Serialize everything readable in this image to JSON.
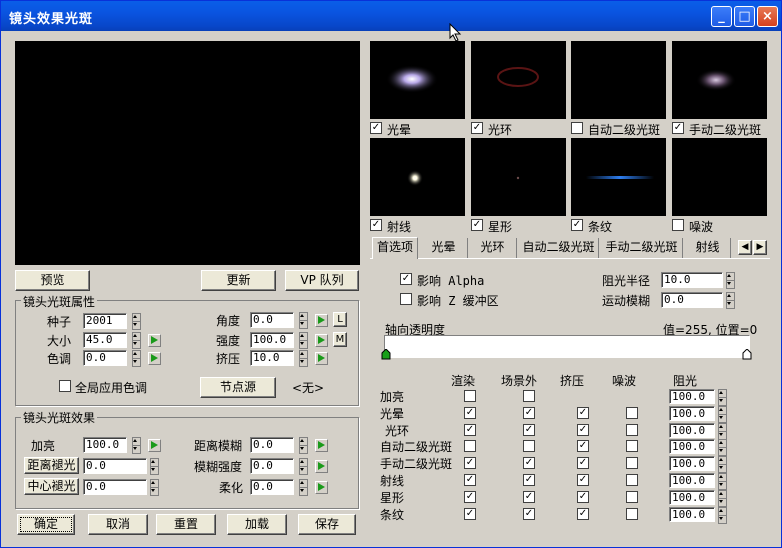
{
  "window": {
    "title": "镜头效果光斑"
  },
  "buttons": {
    "preview": "预览",
    "update": "更新",
    "vp_queue": "VP 队列",
    "node_source": "节点源",
    "ok": "确定",
    "cancel": "取消",
    "reset": "重置",
    "load": "加载",
    "save": "保存",
    "lock": "L",
    "m": "M"
  },
  "props": {
    "title": "镜头光斑属性",
    "seed_label": "种子",
    "seed": "2001",
    "size_label": "大小",
    "size": "45.0",
    "hue_label": "色调",
    "hue": "0.0",
    "angle_label": "角度",
    "angle": "0.0",
    "intensity_label": "强度",
    "intensity": "100.0",
    "squeeze_label": "挤压",
    "squeeze": "10.0",
    "global_hue_label": "全局应用色调",
    "node_value": "<无>"
  },
  "effects": {
    "title": "镜头光斑效果",
    "brighten_label": "加亮",
    "brighten": "100.0",
    "dist_blur_label": "距离模糊",
    "dist_blur": "0.0",
    "dist_fade_label": "距离褪光",
    "dist_fade": "0.0",
    "blur_int_label": "模糊强度",
    "blur_int": "0.0",
    "center_fade_label": "中心褪光",
    "center_fade": "0.0",
    "soften_label": "柔化",
    "soften": "0.0"
  },
  "thumbs": [
    {
      "label": "光晕",
      "checked": true
    },
    {
      "label": "光环",
      "checked": true
    },
    {
      "label": "自动二级光斑",
      "checked": false
    },
    {
      "label": "手动二级光斑",
      "checked": true
    },
    {
      "label": "射线",
      "checked": true
    },
    {
      "label": "星形",
      "checked": true
    },
    {
      "label": "条纹",
      "checked": true
    },
    {
      "label": "噪波",
      "checked": false
    }
  ],
  "tabs": [
    "首选项",
    "光晕",
    "光环",
    "自动二级光斑",
    "手动二级光斑",
    "射线"
  ],
  "prefs": {
    "affect_alpha": "影响 Alpha",
    "affect_alpha_checked": true,
    "affect_z": "影响 Z 缓冲区",
    "affect_z_checked": false,
    "occlusion_radius_label": "阻光半径",
    "occlusion_radius": "10.0",
    "motion_blur_label": "运动模糊",
    "motion_blur": "0.0",
    "axial_label": "轴向透明度",
    "axial_value": "值=255, 位置=0"
  },
  "table": {
    "headers": [
      "渲染",
      "场景外",
      "挤压",
      "噪波",
      "阻光"
    ],
    "rows": [
      {
        "name": "加亮",
        "render": false,
        "offscene": false,
        "squeeze": null,
        "noise": null,
        "occlusion": "100.0"
      },
      {
        "name": "光晕",
        "render": true,
        "offscene": true,
        "squeeze": true,
        "noise": false,
        "occlusion": "100.0"
      },
      {
        "name": "光环",
        "render": true,
        "offscene": true,
        "squeeze": true,
        "noise": false,
        "occlusion": "100.0"
      },
      {
        "name": "自动二级光斑",
        "render": false,
        "offscene": false,
        "squeeze": true,
        "noise": false,
        "occlusion": "100.0"
      },
      {
        "name": "手动二级光斑",
        "render": true,
        "offscene": true,
        "squeeze": true,
        "noise": false,
        "occlusion": "100.0"
      },
      {
        "name": "射线",
        "render": true,
        "offscene": true,
        "squeeze": true,
        "noise": false,
        "occlusion": "100.0"
      },
      {
        "name": "星形",
        "render": true,
        "offscene": true,
        "squeeze": true,
        "noise": false,
        "occlusion": "100.0"
      },
      {
        "name": "条纹",
        "render": true,
        "offscene": true,
        "squeeze": true,
        "noise": false,
        "occlusion": "100.0"
      }
    ]
  },
  "icons": {
    "minimize": "minimize-icon",
    "maximize": "maximize-icon",
    "close": "close-icon",
    "cursor": "cursor-icon"
  }
}
